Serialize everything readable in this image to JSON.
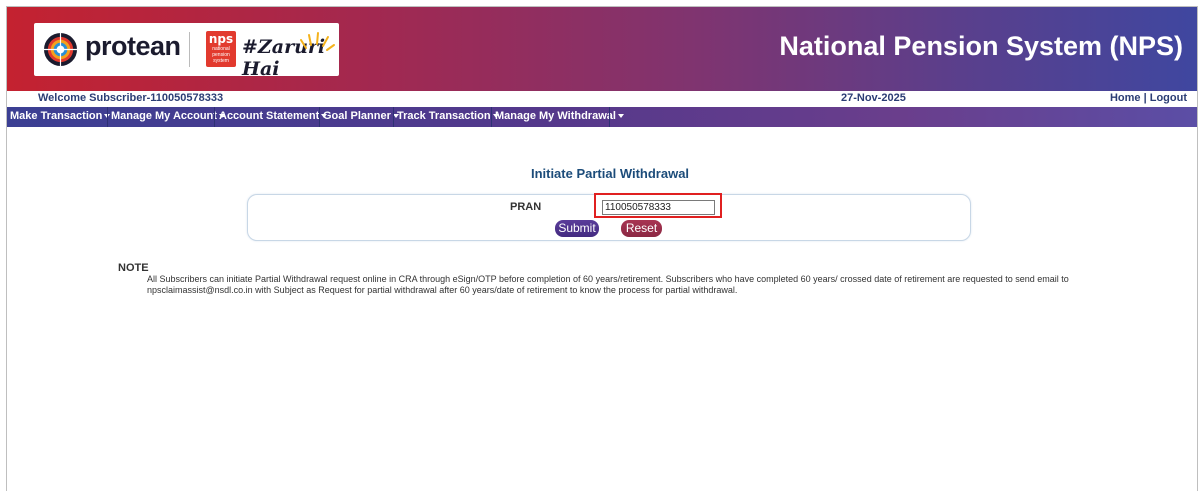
{
  "header": {
    "brand_name": "protean",
    "nps_logo_big": "nps",
    "nps_logo_small": "national pension system",
    "tagline": "#Zaruri Hai",
    "app_title": "National Pension System (NPS)"
  },
  "welcome": {
    "text": "Welcome Subscriber-110050578333",
    "date": "27-Nov-2025",
    "home_label": "Home",
    "separator": " | ",
    "logout_label": "Logout"
  },
  "nav": {
    "items": [
      {
        "label": "Make Transaction"
      },
      {
        "label": "Manage My Account"
      },
      {
        "label": "Account Statement"
      },
      {
        "label": "Goal Planner"
      },
      {
        "label": "Track Transaction"
      },
      {
        "label": "Manage My Withdrawal"
      }
    ]
  },
  "form": {
    "title": "Initiate Partial Withdrawal",
    "pran_label": "PRAN",
    "pran_value": "110050578333",
    "submit_label": "Submit",
    "reset_label": "Reset"
  },
  "note": {
    "label": "NOTE",
    "text": "All Subscribers can initiate Partial Withdrawal request online in CRA through eSign/OTP before completion of 60 years/retirement. Subscribers who have completed 60 years/ crossed date of retirement are requested to send email to npsclaimassist@nsdl.co.in with Subject as Request for partial withdrawal after 60 years/date of retirement to know the process for partial withdrawal."
  },
  "icons": [
    "protean-logo-icon",
    "nps-logo-icon",
    "sun-rays-icon",
    "chevron-down-icon"
  ],
  "colors": {
    "header_start": "#c42230",
    "header_end": "#3f47a0",
    "nav_bg": "#54388b",
    "heading_text": "#1c4c7a",
    "submit_button": "#4f3590",
    "reset_button": "#9a2e4a",
    "highlight_box": "#e02020"
  }
}
